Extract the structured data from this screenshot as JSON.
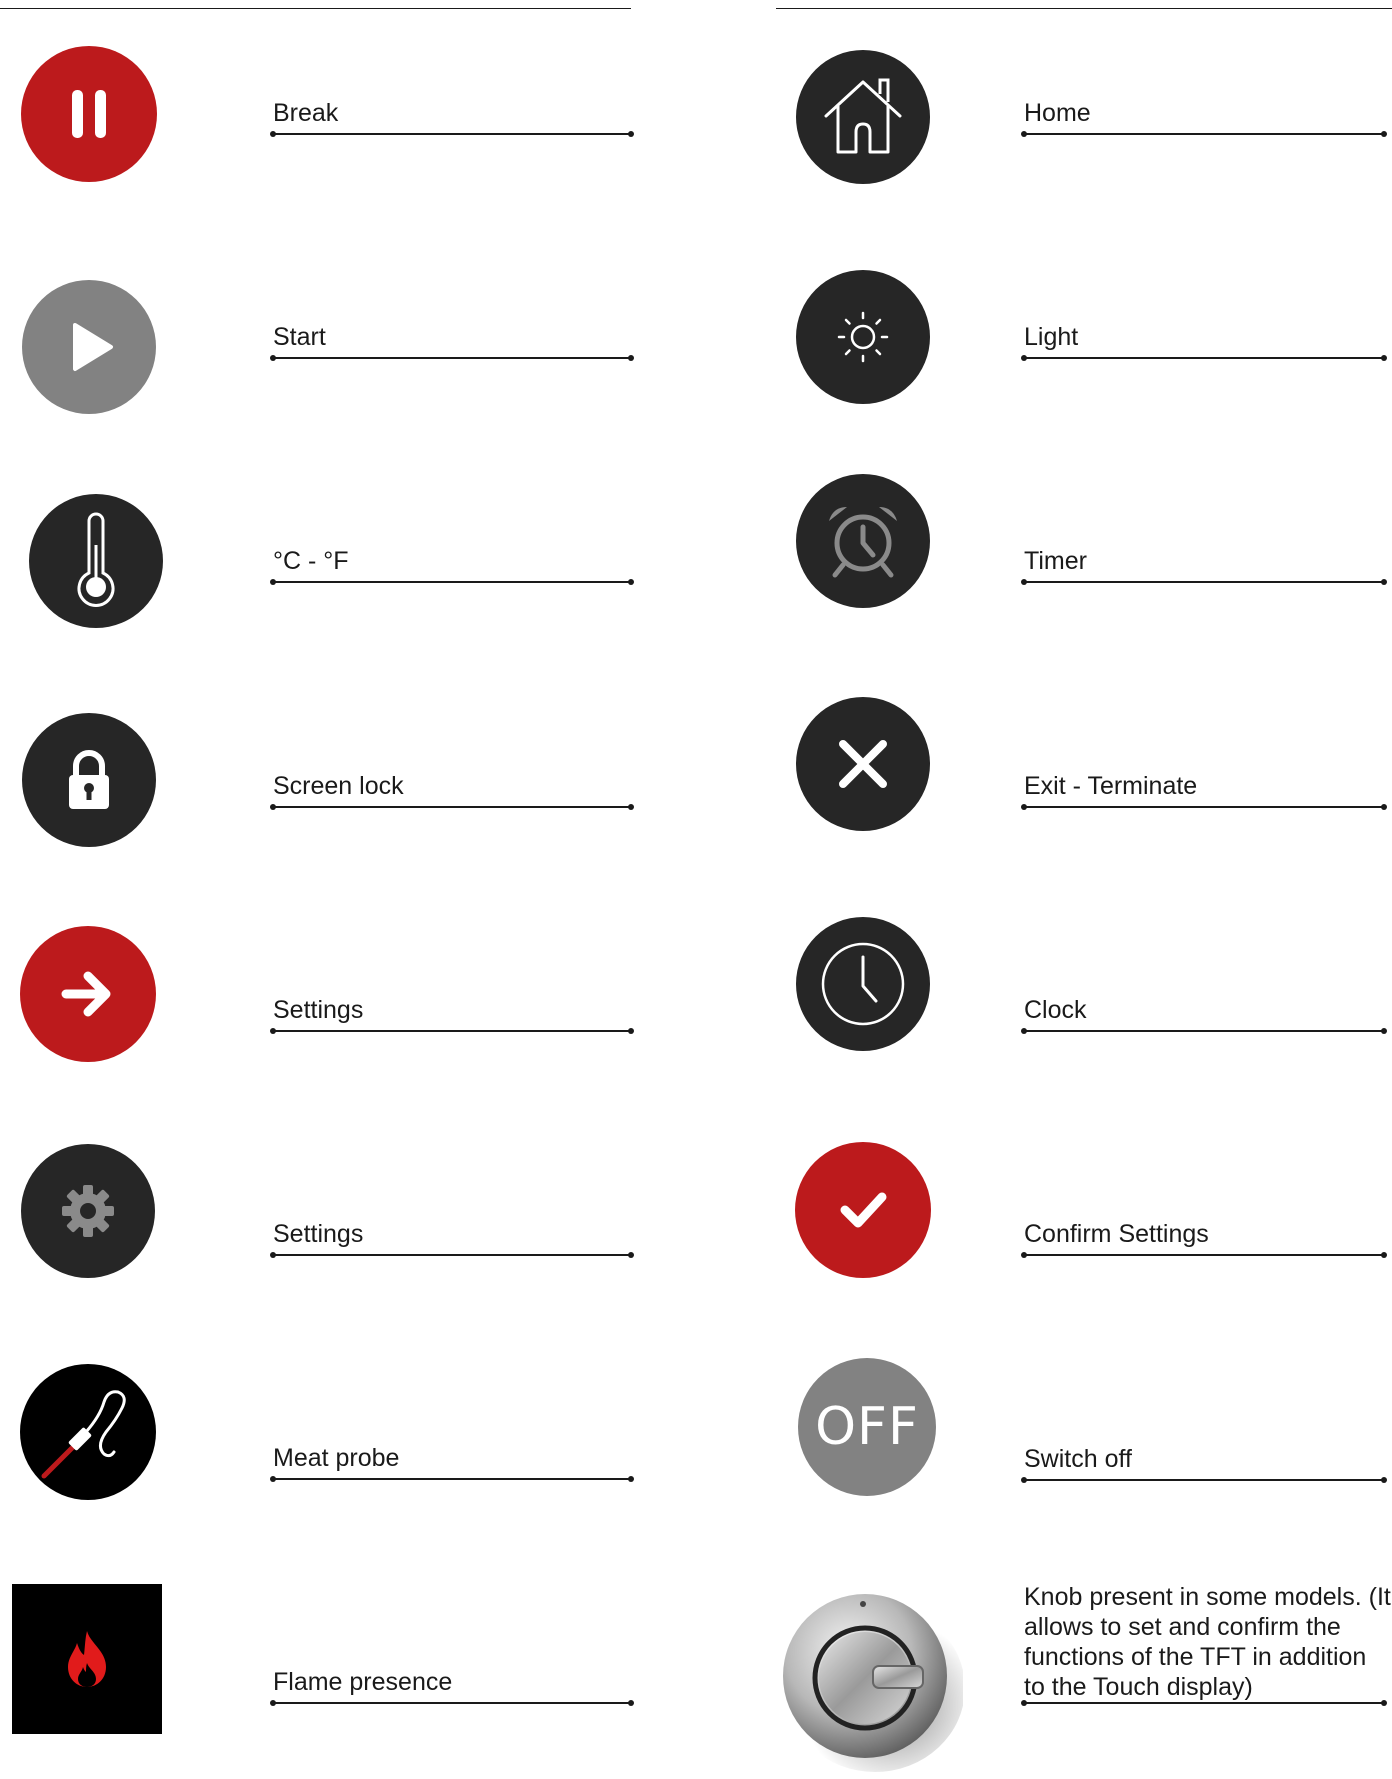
{
  "colors": {
    "dark": "#262626",
    "red": "#bc1a1c",
    "grey": "#828282",
    "black": "#000000"
  },
  "left": [
    {
      "label": "Break",
      "icon": "pause-icon"
    },
    {
      "label": "Start",
      "icon": "play-icon"
    },
    {
      "label": "°C - °F",
      "icon": "thermometer-icon"
    },
    {
      "label": "Screen lock",
      "icon": "lock-icon"
    },
    {
      "label": "Settings",
      "icon": "arrow-right-icon"
    },
    {
      "label": "Settings",
      "icon": "gear-icon"
    },
    {
      "label": "Meat probe",
      "icon": "meat-probe-icon"
    },
    {
      "label": "Flame presence",
      "icon": "flame-icon"
    }
  ],
  "right": [
    {
      "label": "Home",
      "icon": "home-icon"
    },
    {
      "label": "Light",
      "icon": "sun-icon"
    },
    {
      "label": "Timer",
      "icon": "alarm-clock-icon"
    },
    {
      "label": "Exit - Terminate",
      "icon": "close-icon"
    },
    {
      "label": "Clock",
      "icon": "clock-icon"
    },
    {
      "label": "Confirm Settings",
      "icon": "checkmark-icon"
    },
    {
      "label": "Switch off",
      "icon": "off-icon",
      "icon_text": "OFF"
    },
    {
      "label": "Knob present in some models. (It allows to set and confirm the functions of the TFT in addition to the Touch display)",
      "icon": "knob-icon"
    }
  ]
}
